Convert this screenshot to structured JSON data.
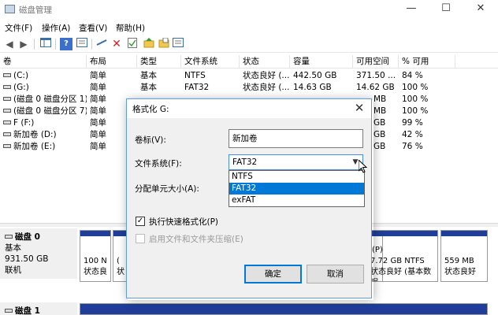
{
  "window": {
    "title": "磁盘管理",
    "minimize_glyph": "—",
    "maximize_glyph": "☐",
    "close_glyph": "✕"
  },
  "menu": [
    "文件(F)",
    "操作(A)",
    "查看(V)",
    "帮助(H)"
  ],
  "toolbar_icons": [
    "back-arrow-icon",
    "forward-arrow-icon",
    "console-tree-icon",
    "help-icon",
    "properties-icon",
    "connect-icon",
    "delete-icon",
    "checklist-icon",
    "new-folder-icon",
    "open-folder-icon",
    "console-view-icon"
  ],
  "table": {
    "headers": [
      "卷",
      "布局",
      "类型",
      "文件系统",
      "状态",
      "容量",
      "可用空间",
      "% 可用"
    ],
    "rows": [
      {
        "name": "(C:)",
        "layout": "简单",
        "type": "基本",
        "fs": "NTFS",
        "status": "状态良好 (...",
        "capacity": "442.50 GB",
        "free": "371.50 ...",
        "pct": "84 %"
      },
      {
        "name": "(G:)",
        "layout": "简单",
        "type": "基本",
        "fs": "FAT32",
        "status": "状态良好 (...",
        "capacity": "14.63 GB",
        "free": "14.62 GB",
        "pct": "100 %"
      },
      {
        "name": "(磁盘 0 磁盘分区 1)",
        "layout": "简单",
        "type": "",
        "fs": "",
        "status": "",
        "capacity": "",
        "free": "MB",
        "pct": "100 %"
      },
      {
        "name": "(磁盘 0 磁盘分区 7)",
        "layout": "简单",
        "type": "",
        "fs": "",
        "status": "",
        "capacity": "",
        "free": "MB",
        "pct": "100 %"
      },
      {
        "name": "F (F:)",
        "layout": "简单",
        "type": "",
        "fs": "",
        "status": "",
        "capacity": "",
        "free": "GB",
        "pct": "99 %"
      },
      {
        "name": "新加卷 (D:)",
        "layout": "简单",
        "type": "",
        "fs": "",
        "status": "",
        "capacity": "",
        "free": "GB",
        "pct": "42 %"
      },
      {
        "name": "新加卷 (E:)",
        "layout": "简单",
        "type": "",
        "fs": "",
        "status": "",
        "capacity": "",
        "free": "GB",
        "pct": "76 %"
      }
    ]
  },
  "disks": [
    {
      "name": "磁盘 0",
      "type": "基本",
      "size": "931.50 GB",
      "state": "联机"
    },
    {
      "name": "磁盘 1"
    }
  ],
  "disk0_partitions": [
    {
      "line1": "100 N",
      "line2": "状态良"
    },
    {
      "line1": "(",
      "line2": "状"
    },
    {
      "line1": "(P)",
      "line2": ""
    },
    {
      "line1": "7.72 GB NTFS",
      "line2": "状态良好 (基本数据"
    },
    {
      "line1": "559 MB",
      "line2": "状态良好"
    }
  ],
  "dialog": {
    "title": "格式化 G:",
    "close_glyph": "✕",
    "volume_label": "卷标(V):",
    "volume_value": "新加卷",
    "fs_label": "文件系统(F):",
    "fs_value": "FAT32",
    "fs_options": [
      "NTFS",
      "FAT32",
      "exFAT"
    ],
    "fs_selected_index": 1,
    "alloc_label": "分配单元大小(A):",
    "quick_format_label": "执行快速格式化(P)",
    "quick_format_checked": true,
    "compression_label": "启用文件和文件夹压缩(E)",
    "compression_checked": false,
    "ok_label": "确定",
    "cancel_label": "取消"
  }
}
